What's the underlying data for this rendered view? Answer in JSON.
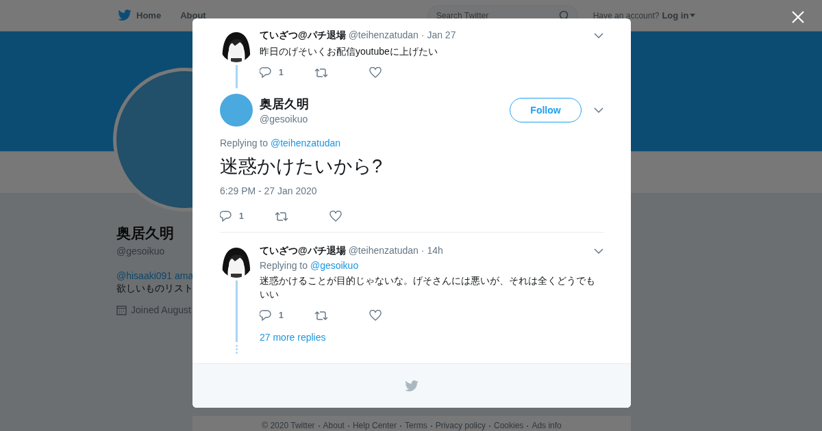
{
  "nav": {
    "items": [
      {
        "label": "Home"
      },
      {
        "label": "About"
      }
    ],
    "search": {
      "placeholder": "Search Twitter"
    },
    "account_prompt": "Have an account?",
    "login": "Log in"
  },
  "profile": {
    "name": "奥居久明",
    "handle": "@gesoikuo",
    "bio_link": "@hisaaki091 ama",
    "bio_text": "欲しいものリスト",
    "joined": "Joined August"
  },
  "modal": {
    "tweets": [
      {
        "kind": "context",
        "name": "ていざつ@パチ退場",
        "handle": "@teihenzatudan",
        "time": "· Jan 27",
        "text": "昨日のげそいくお配信youtubeに上げたい",
        "reply_count": "1"
      },
      {
        "kind": "focus",
        "name": "奥居久明",
        "handle": "@gesoikuo",
        "follow": "Follow",
        "replying_prefix": "Replying to",
        "replying_to": "@teihenzatudan",
        "text": "迷惑かけたいから?",
        "timestamp": "6:29 PM - 27 Jan 2020",
        "reply_count": "1"
      },
      {
        "kind": "reply",
        "name": "ていざつ@パチ退場",
        "handle": "@teihenzatudan",
        "time": "· 14h",
        "replying_prefix": "Replying to",
        "replying_to": "@gesoikuo",
        "text": "迷惑かけることが目的じゃないな。げそさんには悪いが、それは全くどうでもいい",
        "reply_count": "1",
        "more_replies": "27 more replies"
      }
    ]
  },
  "footer_links": [
    "© 2020 Twitter",
    "About",
    "Help Center",
    "Terms",
    "Privacy policy",
    "Cookies",
    "Ads info"
  ]
}
